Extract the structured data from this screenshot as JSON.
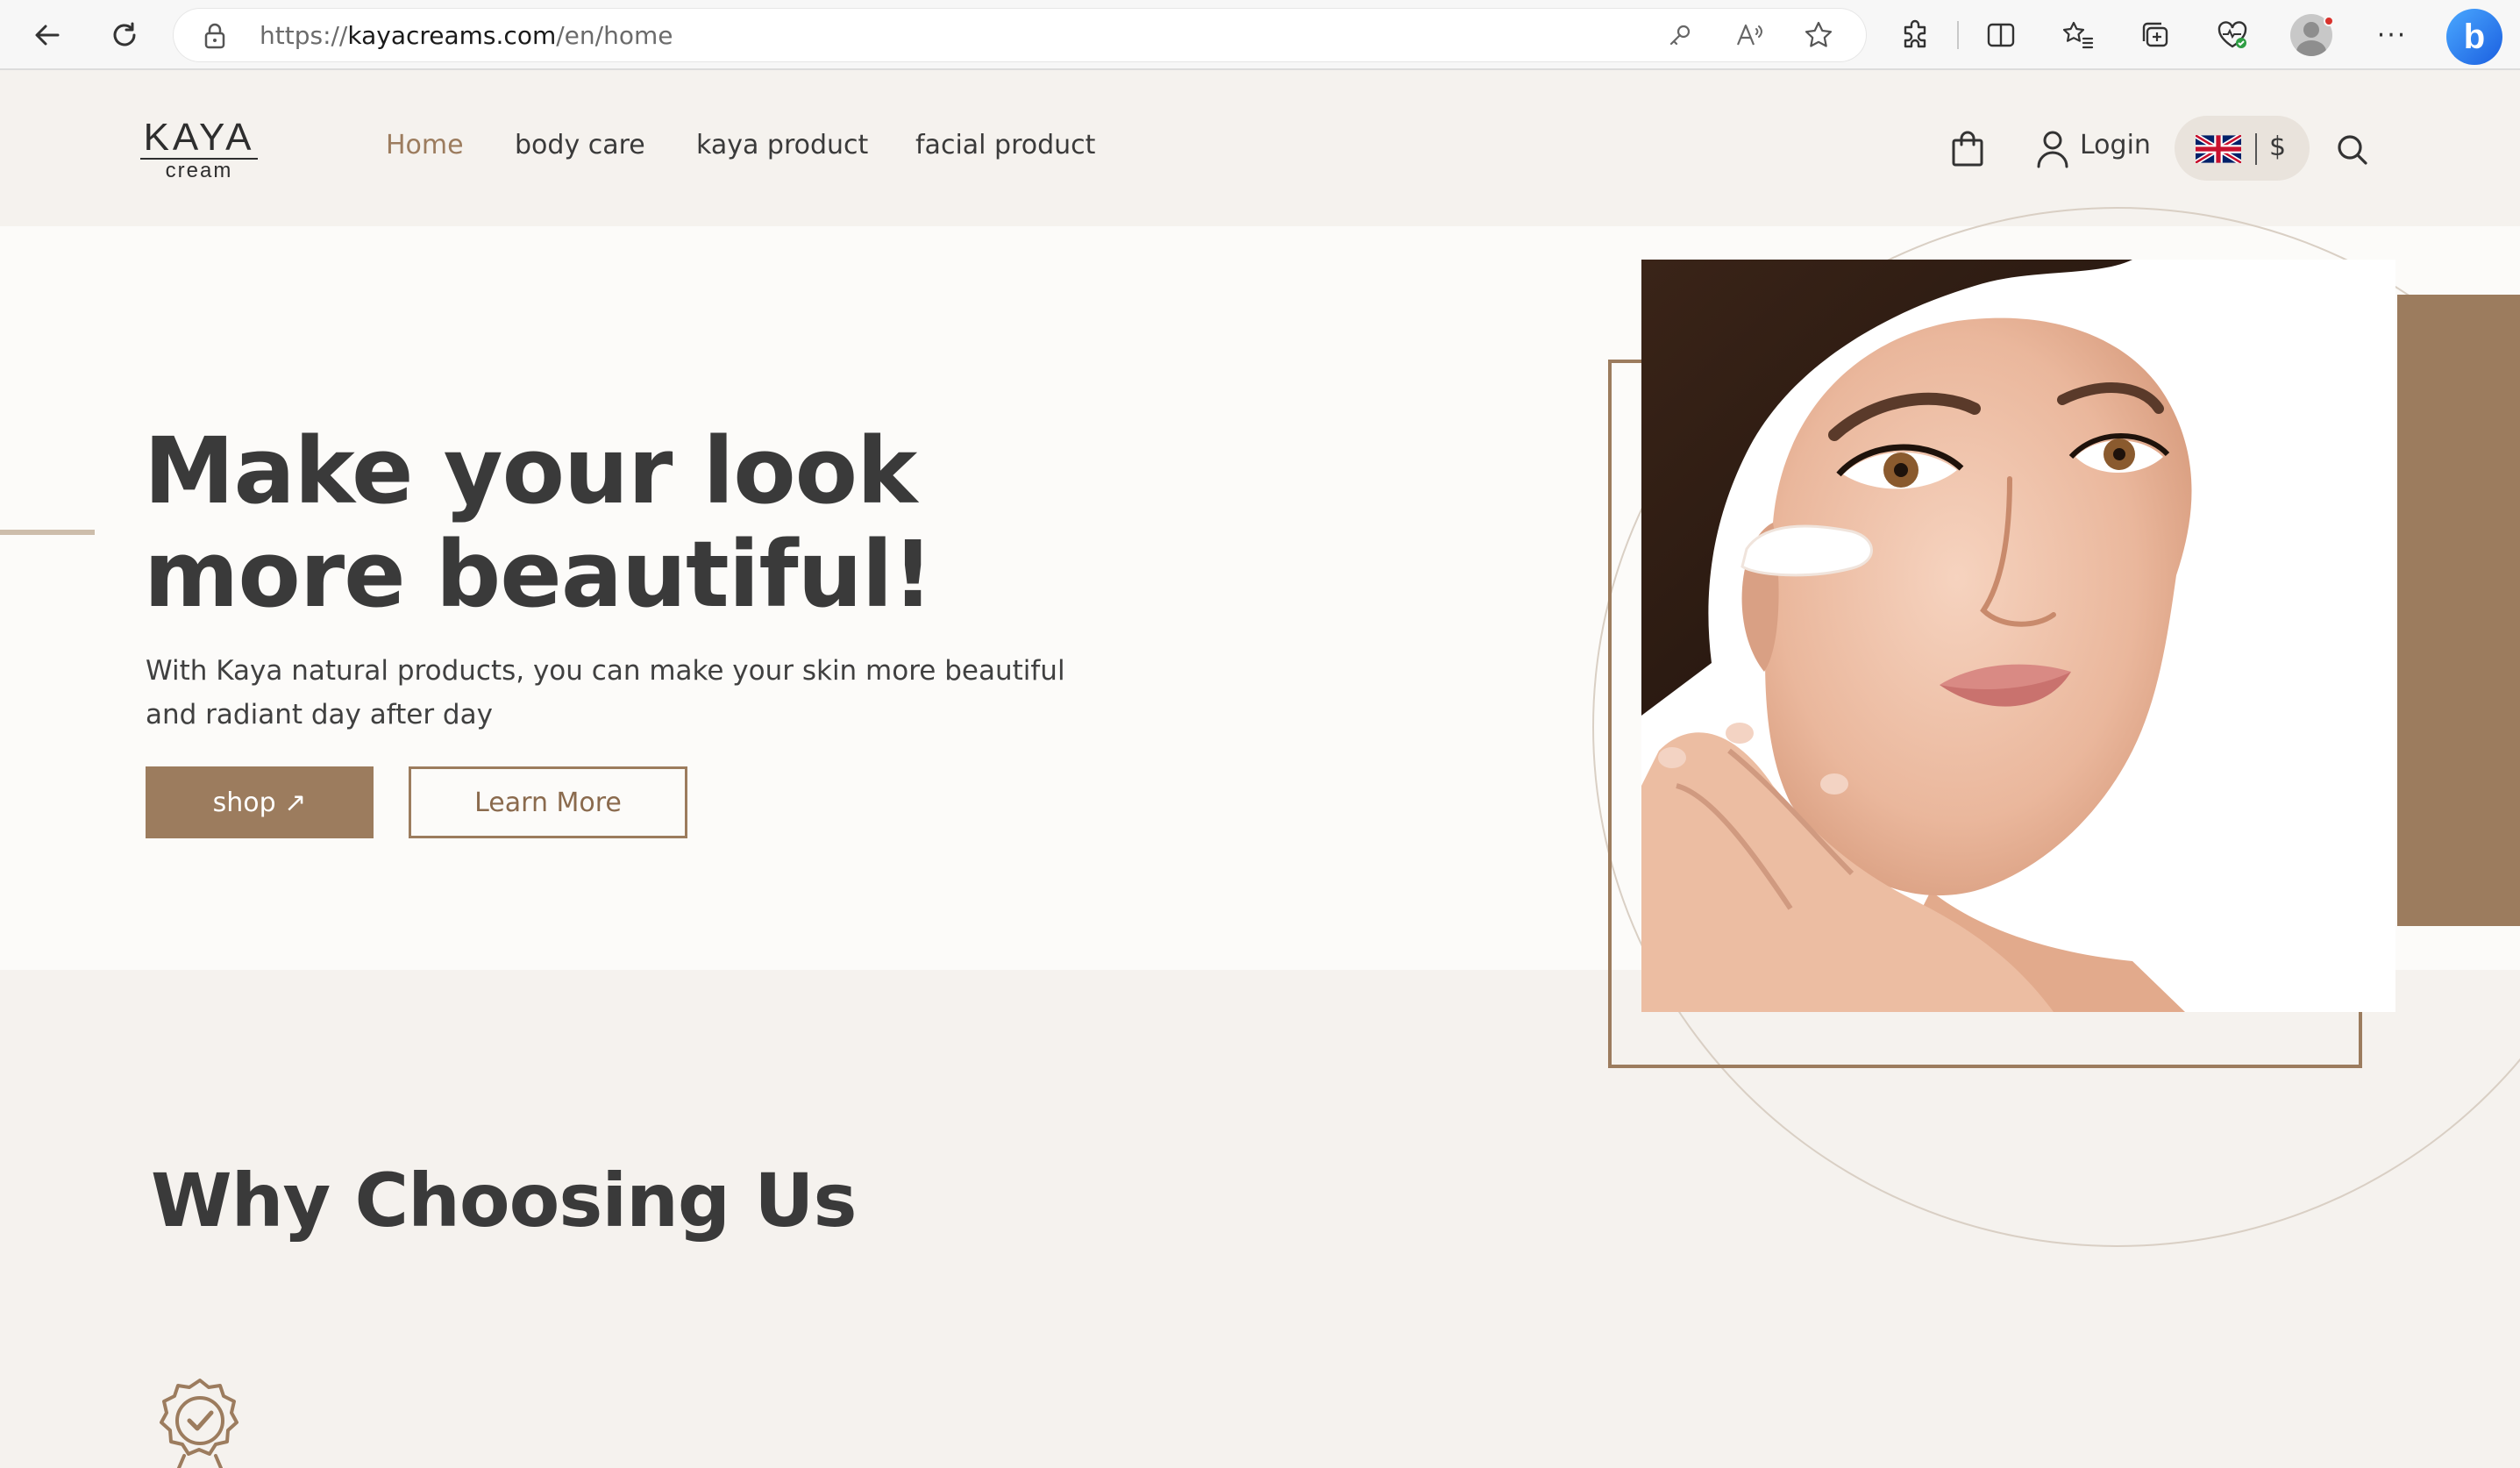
{
  "browser": {
    "url_prefix": "https://",
    "url_domain": "kayacreams.com",
    "url_path": "/en/home",
    "icons": [
      "back-icon",
      "refresh-icon",
      "lock-icon",
      "key-icon",
      "read-aloud-icon",
      "favorite-star-icon",
      "extensions-icon",
      "split-screen-icon",
      "favorites-icon",
      "collections-icon",
      "browser-essentials-icon",
      "profile-avatar",
      "more-icon",
      "bing-icon"
    ],
    "more_label": "···",
    "bing_label": "b"
  },
  "header": {
    "logo_top": "KAYA",
    "logo_bottom": "cream",
    "nav": [
      {
        "label": "Home",
        "active": true
      },
      {
        "label": "body care",
        "active": false
      },
      {
        "label": "kaya product",
        "active": false
      },
      {
        "label": "facial product",
        "active": false
      }
    ],
    "login_label": "Login",
    "currency": "$",
    "icons": [
      "cart-bag-icon",
      "user-icon",
      "uk-flag-icon",
      "search-icon"
    ]
  },
  "hero": {
    "title_line1": "Make your look",
    "title_line2": "more beautiful!",
    "subtitle": "With Kaya natural products, you can make your skin more beautiful and radiant day after day",
    "shop_button": "shop ↗",
    "learn_button": "Learn More",
    "image": "woman-face-cream-photo"
  },
  "why": {
    "title": "Why Choosing Us",
    "icon": "quality-badge-icon"
  },
  "colors": {
    "accent": "#9c7c5e",
    "background": "#f5f2ee",
    "hero_background": "#fcfbf9",
    "text": "#3a3a3a"
  }
}
